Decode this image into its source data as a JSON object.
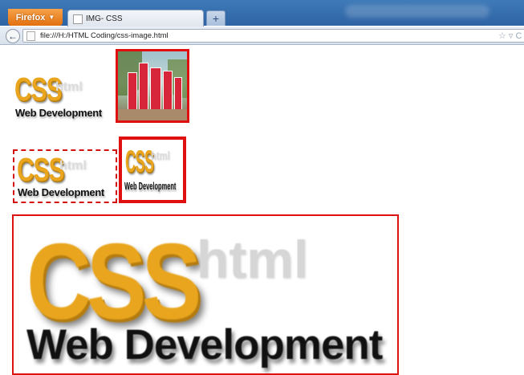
{
  "browser": {
    "menu_button_label": "Firefox",
    "tab_title": "IMG- CSS",
    "new_tab_label": "+",
    "address": "file:///H:/HTML Coding/css-image.html"
  },
  "logo": {
    "css_word": "CSS",
    "html_word": "html",
    "tagline": "Web Development"
  },
  "colors": {
    "border_red": "#e01010",
    "css_gold": "#e8a51d",
    "firefox_orange": "#e2700f",
    "titlebar_blue": "#2e63a4"
  },
  "icons": {
    "back": "back-arrow-icon",
    "bookmark": "star-icon"
  }
}
